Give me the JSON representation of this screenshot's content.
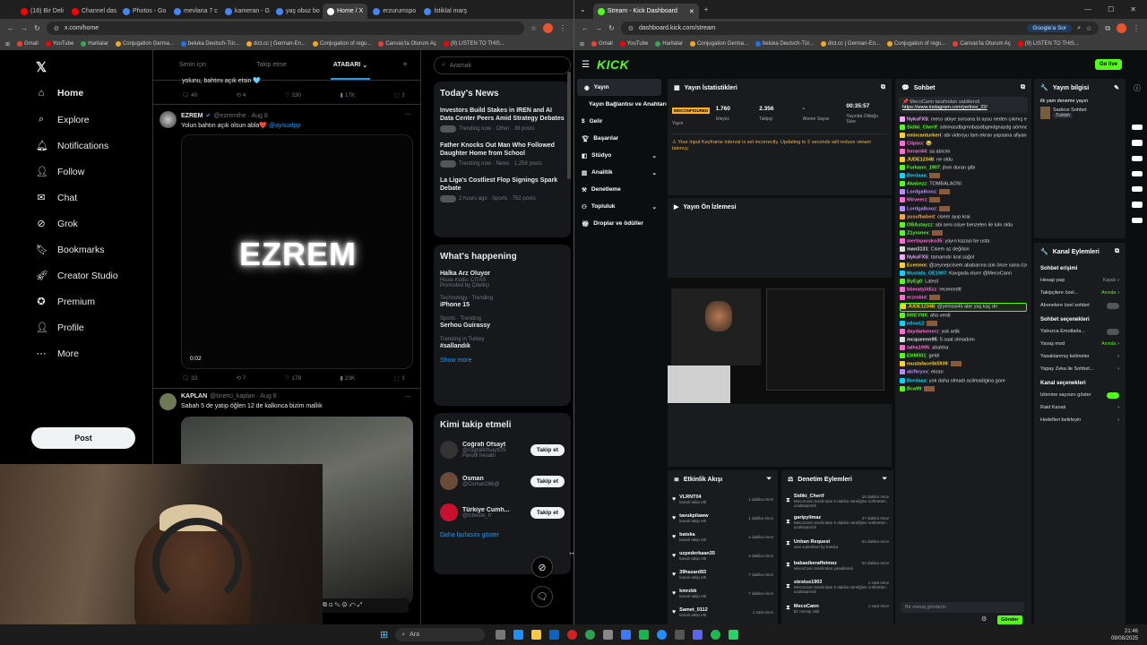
{
  "left_browser": {
    "tabs": [
      {
        "label": "(18) Bir Deli"
      },
      {
        "label": "Channel das"
      },
      {
        "label": "Photos - Go"
      },
      {
        "label": "mevlana 7 c"
      },
      {
        "label": "kameran - G"
      },
      {
        "label": "yaş obuz bo"
      },
      {
        "label": "Home / X",
        "active": true
      },
      {
        "label": "erzurumspo"
      },
      {
        "label": "İstiklal marş"
      }
    ],
    "url": "x.com/home",
    "bookmarks": [
      "Gmail",
      "YouTube",
      "Haritalar",
      "Conjugation Germa...",
      "beluka Deutsch-Tür...",
      "dict.cc | German-En...",
      "Conjugation of regu...",
      "Canvas'ta Oturum Aç",
      "(9) LISTEN TO THIS..."
    ]
  },
  "x_sidebar": {
    "nav": [
      {
        "label": "Home",
        "icon": "home-icon"
      },
      {
        "label": "Explore",
        "icon": "search-icon"
      },
      {
        "label": "Notifications",
        "icon": "bell-icon"
      },
      {
        "label": "Follow",
        "icon": "add-person-icon"
      },
      {
        "label": "Chat",
        "icon": "chat-icon"
      },
      {
        "label": "Grok",
        "icon": "grok-icon"
      },
      {
        "label": "Bookmarks",
        "icon": "bookmark-icon"
      },
      {
        "label": "Creator Studio",
        "icon": "rocket-icon"
      },
      {
        "label": "Premium",
        "icon": "premium-icon"
      },
      {
        "label": "Profile",
        "icon": "person-icon"
      },
      {
        "label": "More",
        "icon": "more-icon"
      }
    ],
    "post_label": "Post"
  },
  "feed": {
    "tabs": [
      "Senin için",
      "Takip etme",
      "ATABARI"
    ],
    "prev_tweet_text": "yolunu, bahtını açık etsin 🩵",
    "prev_actions": {
      "replies": "40",
      "retweets": "4",
      "likes": "330",
      "views": "17K"
    },
    "tweet1": {
      "name": "EZREM",
      "handle": "@ezremthe · Aug 8",
      "text": "Yolun bahtın açık olsun abla❤️",
      "mention": "@aysualpp",
      "video_text": "EZREM",
      "video_time": "0:02",
      "actions": {
        "replies": "33",
        "retweets": "7",
        "likes": "178",
        "views": "23K"
      }
    },
    "tweet2": {
      "name": "KAPLAN",
      "handle": "@tinerci_kaplan · Aug 8",
      "text": "Sabah 5 de yatıp öğlen 12 de kalkınca bizim mallık"
    }
  },
  "right_column": {
    "search_placeholder": "Aramak",
    "news_header": "Today's News",
    "news": [
      {
        "title": "Investors Build Stakes in IREN and AI Data Center Peers Amid Strategy Debates",
        "meta": "Trending now · Other · 39 posts"
      },
      {
        "title": "Father Knocks Out Man Who Followed Daughter Home from School",
        "meta": "Trending now · News · 1,258 posts"
      },
      {
        "title": "La Liga's Costliest Flop Signings Spark Debate",
        "meta": "2 hours ago · Sports · 752 posts"
      }
    ],
    "happening_header": "What's happening",
    "happening": [
      {
        "top": "",
        "title": "Halka Arz Oluyor",
        "sub": "Hisse Kodu: CITAS",
        "meta": "Promoted by Çitelkçi"
      },
      {
        "top": "Technology · Trending",
        "title": "iPhone 15",
        "sub": "",
        "meta": ""
      },
      {
        "top": "Sports · Trending",
        "title": "Serhou Guirassy",
        "sub": "",
        "meta": ""
      },
      {
        "top": "Trending in Turkey",
        "title": "#sallandık",
        "sub": "",
        "meta": ""
      }
    ],
    "show_more": "Show more",
    "wtf_header": "Kimi takip etmeli",
    "who_to_follow": [
      {
        "name": "Coğrafi Ofsayt",
        "handle": "@cografiofsaytGS",
        "note": "Parodi hesabı",
        "button": "Takip et"
      },
      {
        "name": "Osman",
        "handle": "@Osman266@",
        "note": "",
        "button": "Takip et"
      },
      {
        "name": "Türkiye Cumh...",
        "handle": "@tcbeste_fr",
        "note": "",
        "button": "Takip et"
      }
    ],
    "show_more_follow": "Daha fazlasını göster"
  },
  "right_browser": {
    "tab_label": "Stream - Kick Dashboard",
    "url": "dashboard.kick.com/stream",
    "google_btn": "Google'a Sor",
    "bookmarks": [
      "Gmail",
      "YouTube",
      "Haritalar",
      "Conjugation Germa...",
      "beluka Deutsch-Tür...",
      "dict.cc | German-En...",
      "Conjugation of regu...",
      "Canvas'ta Oturum Aç",
      "(9) LISTEN TO THIS..."
    ]
  },
  "kick": {
    "logo": "KICK",
    "live_badge": "Go live",
    "sidebar": [
      {
        "label": "Yayın",
        "icon": "broadcast-icon",
        "active": true
      },
      {
        "label": "Yayın Bağlantısı ve Anahtarı",
        "icon": "",
        "active": false
      },
      {
        "label": "Gelir",
        "icon": "money-icon",
        "active": false
      },
      {
        "label": "Başarılar",
        "icon": "trophy-icon",
        "active": false
      },
      {
        "label": "Stüdyo",
        "icon": "studio-icon",
        "active": false
      },
      {
        "label": "Analitik",
        "icon": "chart-icon",
        "active": false
      },
      {
        "label": "Denetleme",
        "icon": "hammer-icon",
        "active": false
      },
      {
        "label": "Topluluk",
        "icon": "people-icon",
        "active": false
      },
      {
        "label": "Droplar ve ödüller",
        "icon": "gift-icon",
        "active": false
      }
    ],
    "stats_title": "Yayın İstatistikleri",
    "stats": [
      {
        "value": "MISCONFIGURED",
        "label": "Yayın"
      },
      {
        "value": "1.760",
        "label": "İzleyici"
      },
      {
        "value": "2.356",
        "label": "Takipçi"
      },
      {
        "value": "-",
        "label": "Abone Sayısı"
      },
      {
        "value": "00:35:57",
        "label": "Yayında Olduğu Süre"
      }
    ],
    "warning": "Your input Keyframe interval is set incorrectly. Updating to 2 seconds will reduce viewer latency.",
    "preview_title": "Yayın Ön İzlemesi",
    "activity_title": "Etkinlik Akışı",
    "activity": [
      {
        "user": "VLRNT04",
        "action": "kanalı takip etti",
        "time": "1 dakika önce"
      },
      {
        "user": "tavukpilaww",
        "action": "kanalı takip etti",
        "time": "1 dakika önce"
      },
      {
        "user": "batska",
        "action": "kanalı takip etti",
        "time": "4 dakika önce"
      },
      {
        "user": "uzpederkaan35",
        "action": "kanalı takip etti",
        "time": "4 dakika önce"
      },
      {
        "user": "39hazard93",
        "action": "kanalı takip etti",
        "time": "7 dakika önce"
      },
      {
        "user": "kmrzbk",
        "action": "kanalı takip etti",
        "time": "7 dakika önce"
      },
      {
        "user": "Samet_0112",
        "action": "kanalı takip etti",
        "time": "1 saat önce"
      }
    ],
    "moderation_title": "Denetim Eylemleri",
    "moderation": [
      {
        "user": "Sidiki_Cherif",
        "detail": "MecoCann tarafından 5 dakika süreliğine sohbetten uzaklaştırıldı",
        "time": "18 dakika önce"
      },
      {
        "user": "garipyilmaz",
        "detail": "MecoCann tarafından 5 dakika süreliğine sohbetten uzaklaştırıldı",
        "time": "37 dakika önce"
      },
      {
        "user": "Unban Request",
        "detail": "was submitted by batska",
        "time": "54 dakika önce"
      },
      {
        "user": "babasikeraffetmez",
        "detail": "MecoCann tarafından yasaklandı",
        "time": "54 dakika önce"
      },
      {
        "user": "stestus1903",
        "detail": "MecoCann tarafından 5 dakika süreliğine sohbetten uzaklaştırıldı",
        "time": "1 saat önce"
      },
      {
        "user": "MecoCann",
        "detail": "bir mesajı sildi",
        "time": "1 saat önce"
      }
    ],
    "chat_title": "Sohbet",
    "pinned_by": "MecoCann tarafından sabitlendi",
    "pinned_link": "https://www.instagram.com/yerlissi_22/",
    "chat": [
      {
        "user": "NyksFXS",
        "msg": "meco abiye sorsana bi aysu neden çıkmış ekipten",
        "color": "#f2a8ff"
      },
      {
        "user": "Sidiki_Cherif",
        "msg": "sdnmasdbgmnbasdbgmdgnasdg aömncgdgasdg",
        "color": "#53fc18"
      },
      {
        "user": "emircanturkeri",
        "msg": "abi videoyu tam ekran yapsana afiyan gözükmüyo",
        "color": "#ffd21f"
      },
      {
        "user": "Clipixx",
        "msg": "😂",
        "color": "#ff6bd4"
      },
      {
        "user": "ferrari44",
        "msg": "sa abicim",
        "color": "#ff6bd4"
      },
      {
        "user": "JUDE12348",
        "msg": "ne oldu",
        "color": "#ffd21f"
      },
      {
        "user": "Furkann_1907",
        "msg": "jhon duran gibi",
        "color": "#53fc18"
      },
      {
        "user": "Berdaaa",
        "msg": "",
        "color": "#00d8ff"
      },
      {
        "user": "Akabnzz",
        "msg": "TOMBALAOSİ",
        "color": "#53fc18"
      },
      {
        "user": "Lordgalkooz",
        "msg": "",
        "color": "#b78cff"
      },
      {
        "user": "Mirveerz",
        "msg": "",
        "color": "#ff6bd4"
      },
      {
        "user": "Lordgalkooz",
        "msg": "",
        "color": "#b78cff"
      },
      {
        "user": "yusufbabed",
        "msg": "cisem ayıp krai",
        "color": "#ff9f40"
      },
      {
        "user": "OBAstayzz",
        "msg": "abi seni osiye benzeten ile kim oldu",
        "color": "#53fc18"
      },
      {
        "user": "Z1yronex",
        "msg": "",
        "color": "#53fc18"
      },
      {
        "user": "mertoparsko35",
        "msg": "yayın kazasi be usta",
        "color": "#ff6bd4"
      },
      {
        "user": "man3131",
        "msg": "Cisem az değilsin",
        "color": "#ddd"
      },
      {
        "user": "NyksFXS",
        "msg": "tamamdır kral sağol",
        "color": "#f2a8ff"
      },
      {
        "user": "Ecermm",
        "msg": "@zeynepcisem ababarına sok önce sana özelde o",
        "color": "#ffd21f"
      },
      {
        "user": "Mustafa_OE1907",
        "msg": "Kavgada olurrr @MecoCann",
        "color": "#00d8ff"
      },
      {
        "user": "ByEg0",
        "msg": "Latest",
        "color": "#53fc18"
      },
      {
        "user": "bberatyildizz",
        "msg": "recennnttt",
        "color": "#ff6bd4"
      },
      {
        "user": "erzrobid",
        "msg": "",
        "color": "#ff6bd4"
      },
      {
        "user": "JUDE12348",
        "msg": "@yerlissi45 abe yaş kaç dır",
        "color": "#ffd21f"
      },
      {
        "user": "RREYNX",
        "msg": "aha verdi",
        "color": "#53fc18"
      },
      {
        "user": "niloo12",
        "msg": "",
        "color": "#00d8ff"
      },
      {
        "user": "daydarkenerz",
        "msg": "yok artik",
        "color": "#ff6bd4"
      },
      {
        "user": "mcqueenn95",
        "msg": "5 saat olmadımı",
        "color": "#ddd"
      },
      {
        "user": "talha1995",
        "msg": "ahahha",
        "color": "#ff6bd4"
      },
      {
        "user": "EHM001",
        "msg": "geldi",
        "color": "#53fc18"
      },
      {
        "user": "mustafacelik5939",
        "msg": "",
        "color": "#ffd21f"
      },
      {
        "user": "akifkryxx",
        "msg": "ekran",
        "color": "#b78cff"
      },
      {
        "user": "Berdaaa",
        "msg": "yok daha olmadı acilmadigina gore",
        "color": "#00d8ff"
      },
      {
        "user": "Bca99",
        "msg": "",
        "color": "#53fc18"
      }
    ],
    "chat_placeholder": "Bir mesaj gönderin",
    "send_label": "Gönder",
    "info_title": "Yayın bilgisi",
    "info_stream_title": "ilk yam deneme yayın",
    "info_category": "Sadece Sohbet",
    "info_tag": "Turkish",
    "channel_title": "Kanal Eylemleri",
    "channel_sections": [
      {
        "header": "Sohbet erişimi",
        "rows": [
          {
            "label": "Hesap yaşı",
            "value": "Kapalı"
          },
          {
            "label": "Takipçilere özel...",
            "value": "Anında"
          },
          {
            "label": "Abonelere özel sohbet",
            "value": "toggle-off"
          }
        ]
      },
      {
        "header": "Sohbet seçenekleri",
        "rows": [
          {
            "label": "Yalnızca Emotlarla...",
            "value": "toggle-off"
          },
          {
            "label": "Yavaş mod",
            "value": "Anında"
          },
          {
            "label": "Yasaklanmış kelimeler",
            "value": ""
          },
          {
            "label": "Yapay Zeka ile Sohbet...",
            "value": ""
          }
        ]
      },
      {
        "header": "Kanal seçenekleri",
        "rows": [
          {
            "label": "İzlenme sayısını göster",
            "value": "toggle-on"
          },
          {
            "label": "Raid Kanalı",
            "value": ""
          },
          {
            "label": "Hedefleri belirleyin",
            "value": ""
          }
        ]
      }
    ]
  },
  "taskbar": {
    "search_placeholder": "Ara",
    "time": "21:46",
    "date": "09/08/2025"
  }
}
